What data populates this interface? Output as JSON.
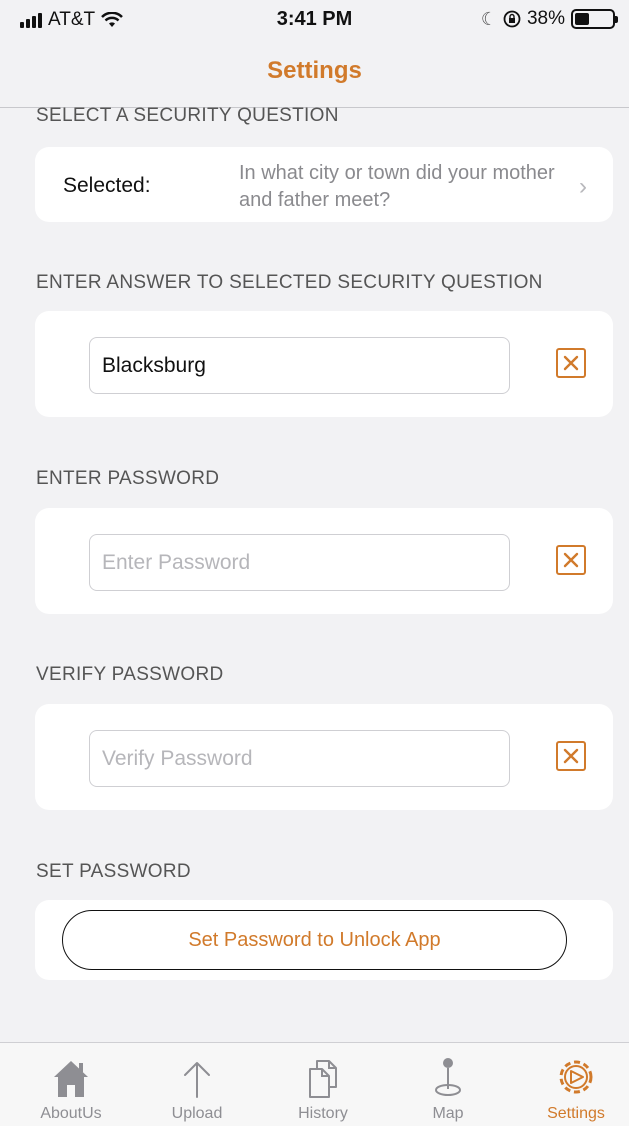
{
  "status_bar": {
    "carrier": "AT&T",
    "time": "3:41 PM",
    "battery_text": "38%",
    "battery_level": 0.38,
    "icons": [
      "signal-icon",
      "wifi-icon",
      "moon-icon",
      "rotation-lock-icon",
      "battery-icon"
    ]
  },
  "nav": {
    "title": "Settings"
  },
  "security_question": {
    "header": "SELECT A SECURITY QUESTION",
    "selected_label": "Selected:",
    "selected_value": "In what city or town did your mother and father meet?",
    "chevron": "›"
  },
  "answer": {
    "header": "ENTER ANSWER TO SELECTED SECURITY QUESTION",
    "value": "Blacksburg",
    "placeholder": ""
  },
  "password": {
    "header": "ENTER PASSWORD",
    "value": "",
    "placeholder": "Enter Password"
  },
  "verify": {
    "header": "VERIFY PASSWORD",
    "value": "",
    "placeholder": "Verify Password"
  },
  "set_password": {
    "header": "SET PASSWORD",
    "button_label": "Set Password to Unlock App"
  },
  "tabs": [
    {
      "label": "AboutUs",
      "icon": "home-icon",
      "active": false
    },
    {
      "label": "Upload",
      "icon": "upload-arrow-icon",
      "active": false
    },
    {
      "label": "History",
      "icon": "documents-icon",
      "active": false
    },
    {
      "label": "Map",
      "icon": "map-pin-icon",
      "active": false
    },
    {
      "label": "Settings",
      "icon": "gear-icon",
      "active": true
    }
  ],
  "colors": {
    "accent": "#d17a2b",
    "background": "#f2f2f4",
    "card": "#ffffff",
    "inactive_tab": "#8e8e93"
  }
}
